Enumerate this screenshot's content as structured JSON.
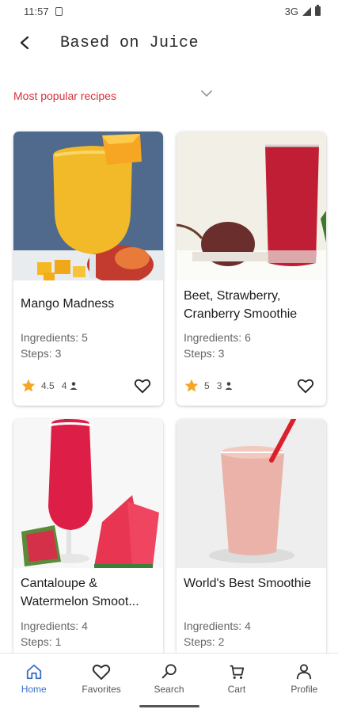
{
  "status_bar": {
    "time": "11:57",
    "network": "3G"
  },
  "header": {
    "title": "Based on Juice"
  },
  "sort": {
    "label": "Most popular recipes"
  },
  "labels": {
    "ingredients_prefix": "Ingredients: ",
    "steps_prefix": "Steps: "
  },
  "recipes": [
    {
      "title": "Mango Madness",
      "ingredients": 5,
      "steps": 3,
      "rating": "4.5",
      "ratings_count": "4"
    },
    {
      "title": "Beet, Strawberry, Cranberry Smoothie",
      "ingredients": 6,
      "steps": 3,
      "rating": "5",
      "ratings_count": "3"
    },
    {
      "title": "Cantaloupe & Watermelon Smoot...",
      "ingredients": 4,
      "steps": 1
    },
    {
      "title": "World's Best Smoothie",
      "ingredients": 4,
      "steps": 2
    }
  ],
  "nav": {
    "items": [
      {
        "label": "Home",
        "icon": "home-icon",
        "active": true
      },
      {
        "label": "Favorites",
        "icon": "heart-icon"
      },
      {
        "label": "Search",
        "icon": "search-icon"
      },
      {
        "label": "Cart",
        "icon": "cart-icon"
      },
      {
        "label": "Profile",
        "icon": "person-icon"
      }
    ]
  },
  "colors": {
    "accent_red": "#d6303a",
    "nav_active": "#3a6fc6",
    "star": "#f5a623"
  }
}
